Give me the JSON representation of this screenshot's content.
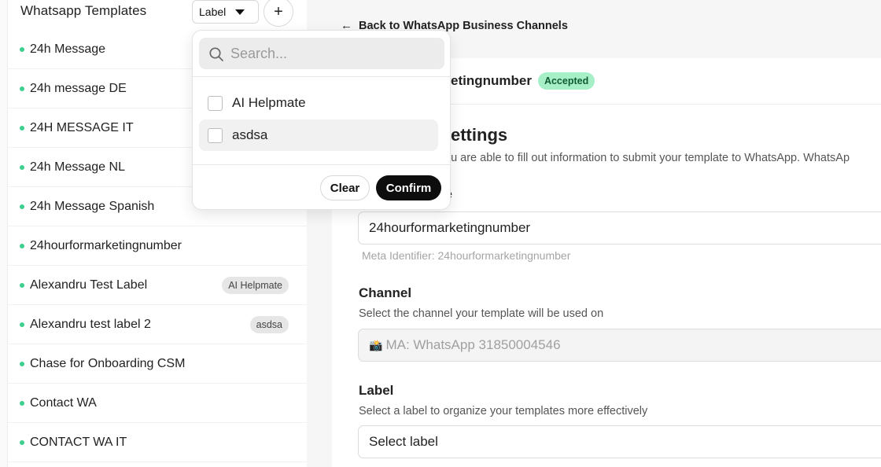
{
  "sidebar": {
    "title": "Whatsapp Templates",
    "label_filter": "Label",
    "add_button": "+",
    "templates": [
      {
        "name": "24h Message",
        "tag": ""
      },
      {
        "name": "24h message DE",
        "tag": ""
      },
      {
        "name": "24H MESSAGE IT",
        "tag": ""
      },
      {
        "name": "24h Message NL",
        "tag": ""
      },
      {
        "name": "24h Message Spanish",
        "tag": ""
      },
      {
        "name": "24hourformarketingnumber",
        "tag": ""
      },
      {
        "name": "Alexandru Test Label",
        "tag": "AI Helpmate"
      },
      {
        "name": "Alexandru test label 2",
        "tag": "asdsa"
      },
      {
        "name": "Chase for Onboarding CSM",
        "tag": ""
      },
      {
        "name": "Contact WA",
        "tag": ""
      },
      {
        "name": "CONTACT WA IT",
        "tag": ""
      }
    ]
  },
  "label_dropdown": {
    "search_placeholder": "Search...",
    "options": [
      "AI Helpmate",
      "asdsa"
    ],
    "clear_label": "Clear",
    "confirm_label": "Confirm"
  },
  "main": {
    "back_link": "Back to WhatsApp Business Channels",
    "template_name_partial": "etingnumber",
    "status_badge": "Accepted",
    "settings_title_partial": "ettings",
    "settings_desc_partial": "ou are able to fill out information to submit your template to WhatsApp. WhatsAp",
    "name_label_partial": "e",
    "name_value": "24hourformarketingnumber",
    "meta_identifier": "Meta Identifier: 24hourformarketingnumber",
    "channel_label": "Channel",
    "channel_help": "Select the channel your template will be used on",
    "channel_value": "MA: WhatsApp 31850004546",
    "label_label": "Label",
    "label_help": "Select a label to organize your templates more effectively",
    "label_select": "Select label"
  },
  "colors": {
    "status_dot": "#3ecf8e",
    "accepted_bg": "#a7efc7",
    "confirm_bg": "#0d0d0d"
  }
}
